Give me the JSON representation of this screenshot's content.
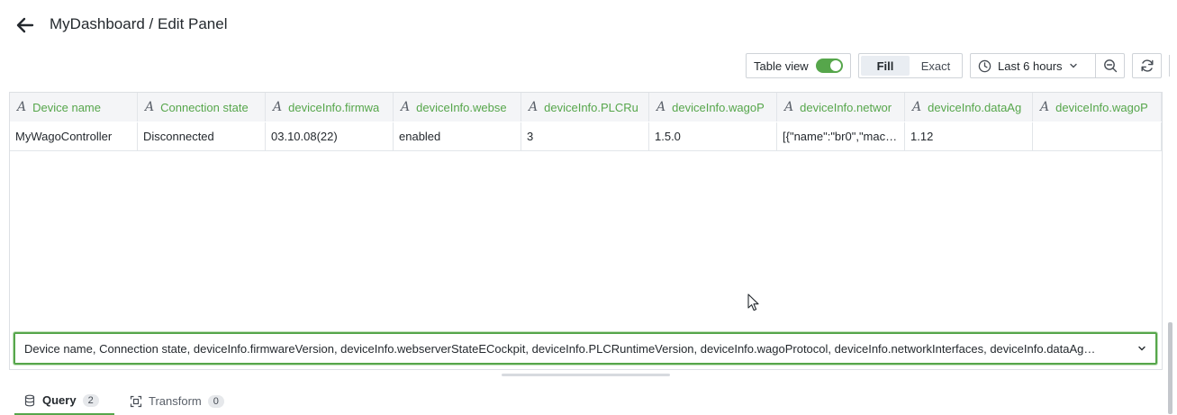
{
  "header": {
    "title": "MyDashboard / Edit Panel",
    "back_icon": "arrow-left-icon"
  },
  "toolbar": {
    "table_view_label": "Table view",
    "table_view_on": true,
    "fill_label": "Fill",
    "exact_label": "Exact",
    "active_mode": "Fill",
    "time_range_label": "Last 6 hours"
  },
  "table": {
    "columns": [
      "Device name",
      "Connection state",
      "deviceInfo.firmwa",
      "deviceInfo.webse",
      "deviceInfo.PLCRu",
      "deviceInfo.wagoP",
      "deviceInfo.networ",
      "deviceInfo.dataAg",
      "deviceInfo.wagoP"
    ],
    "rows": [
      [
        "MyWagoController",
        "Disconnected",
        "03.10.08(22)",
        "enabled",
        "3",
        "1.5.0",
        "[{\"name\":\"br0\",\"mac\":\"…",
        "1.12",
        ""
      ]
    ]
  },
  "field_select": {
    "value": "Device name, Connection state, deviceInfo.firmwareVersion, deviceInfo.webserverStateECockpit, deviceInfo.PLCRuntimeVersion, deviceInfo.wagoProtocol, deviceInfo.networkInterfaces, deviceInfo.dataAg…"
  },
  "tabs": [
    {
      "label": "Query",
      "count": "2",
      "icon": "database-icon"
    },
    {
      "label": "Transform",
      "count": "0",
      "icon": "transform-icon"
    }
  ],
  "colors": {
    "accent": "#56a64b",
    "text": "#24292e",
    "header_bg": "#f4f5f7",
    "border": "#cfd3d8"
  }
}
